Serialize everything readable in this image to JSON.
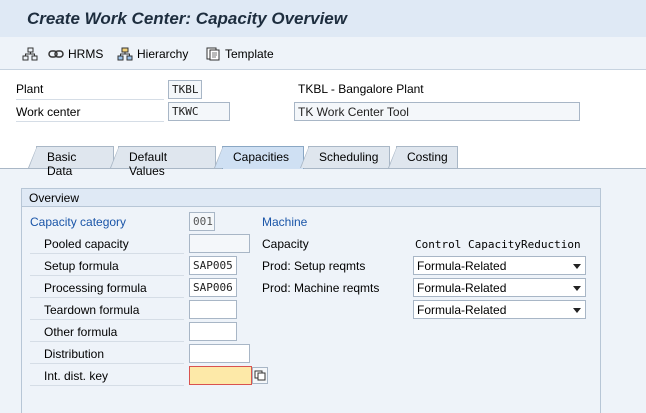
{
  "window": {
    "title": "Create Work Center: Capacity Overview"
  },
  "toolbar": {
    "hrms_label": "HRMS",
    "hierarchy_label": "Hierarchy",
    "template_label": "Template"
  },
  "header": {
    "plant_label": "Plant",
    "plant_value": "TKBL",
    "plant_desc": "TKBL - Bangalore Plant",
    "workcenter_label": "Work center",
    "workcenter_value": "TKWC",
    "workcenter_desc": "TK Work Center Tool"
  },
  "tabs": [
    {
      "label": "Basic Data"
    },
    {
      "label": "Default Values"
    },
    {
      "label": "Capacities"
    },
    {
      "label": "Scheduling"
    },
    {
      "label": "Costing"
    }
  ],
  "overview": {
    "group_title": "Overview",
    "capacity_category_label": "Capacity category",
    "capacity_category_value": "001",
    "capacity_category_desc": "Machine",
    "pooled_capacity_label": "Pooled capacity",
    "pooled_capacity_value": "",
    "setup_formula_label": "Setup formula",
    "setup_formula_value": "SAP005",
    "processing_formula_label": "Processing formula",
    "processing_formula_value": "SAP006",
    "teardown_formula_label": "Teardown formula",
    "teardown_formula_value": "",
    "other_formula_label": "Other formula",
    "other_formula_value": "",
    "distribution_label": "Distribution",
    "distribution_value": "",
    "int_dist_key_label": "Int. dist. key",
    "int_dist_key_value": "",
    "col_capacity": "Capacity",
    "col_control": "Control CapacityReduction",
    "prod_setup_label": "Prod: Setup reqmts",
    "prod_machine_label": "Prod: Machine reqmts",
    "dropdown1_value": "Formula-Related",
    "dropdown2_value": "Formula-Related",
    "dropdown3_value": "Formula-Related"
  }
}
